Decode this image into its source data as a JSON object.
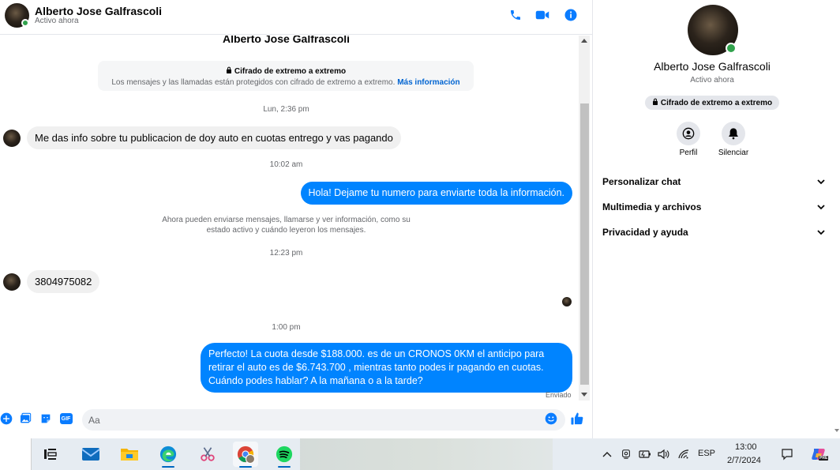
{
  "header": {
    "name": "Alberto Jose Galfrascoli",
    "status": "Activo ahora",
    "icons": [
      "phone-icon",
      "video-icon",
      "info-icon"
    ]
  },
  "chat": {
    "top_name": "Alberto Jose Galfrascoli",
    "e2e_title": "Cifrado de extremo a extremo",
    "e2e_desc": "Los mensajes y las llamadas están protegidos con cifrado de extremo a extremo.",
    "e2e_link": "Más información",
    "messages": [
      {
        "type": "time",
        "text": "Lun, 2:36 pm"
      },
      {
        "type": "in",
        "text": "Me das info sobre tu publicacion de doy auto en cuotas entrego y vas pagando"
      },
      {
        "type": "time",
        "text": "10:02 am"
      },
      {
        "type": "out",
        "text": "Hola! Dejame tu numero  para enviarte toda la información."
      },
      {
        "type": "system",
        "text": "Ahora pueden enviarse mensajes, llamarse y ver información, como su estado activo y cuándo leyeron los mensajes."
      },
      {
        "type": "time",
        "text": "12:23 pm"
      },
      {
        "type": "in",
        "text": "3804975082"
      },
      {
        "type": "time",
        "text": "1:00 pm"
      },
      {
        "type": "out",
        "text": "Perfecto! La cuota desde $188.000. es de un CRONOS 0KM el anticipo para retirar el auto es de $6.743.700 , mientras tanto podes ir pagando en cuotas. Cuándo podes hablar? A la mañana o a la tarde?"
      }
    ],
    "sent_label": "Enviado"
  },
  "composer": {
    "placeholder": "Aa",
    "icons": [
      "plus-icon",
      "image-icon",
      "sticker-icon",
      "gif-icon",
      "emoji-icon",
      "like-icon"
    ],
    "gif_label": "GIF"
  },
  "side": {
    "name": "Alberto Jose Galfrascoli",
    "status": "Activo ahora",
    "badge": "Cifrado de extremo a extremo",
    "actions": [
      {
        "label": "Perfil",
        "icon": "profile-icon"
      },
      {
        "label": "Silenciar",
        "icon": "bell-icon"
      }
    ],
    "sections": [
      "Personalizar chat",
      "Multimedia y archivos",
      "Privacidad y ayuda"
    ]
  },
  "taskbar": {
    "apps": [
      "task-view-icon",
      "mail-icon",
      "file-explorer-icon",
      "edge-icon",
      "snipping-tool-icon",
      "chrome-icon",
      "spotify-icon"
    ],
    "language": "ESP",
    "time": "13:00",
    "date": "2/7/2024",
    "copilot_badge": "PRE"
  },
  "colors": {
    "accent": "#0084ff",
    "online": "#31a24c",
    "link": "#0064d1",
    "icon_blue": "#0a7cff"
  }
}
